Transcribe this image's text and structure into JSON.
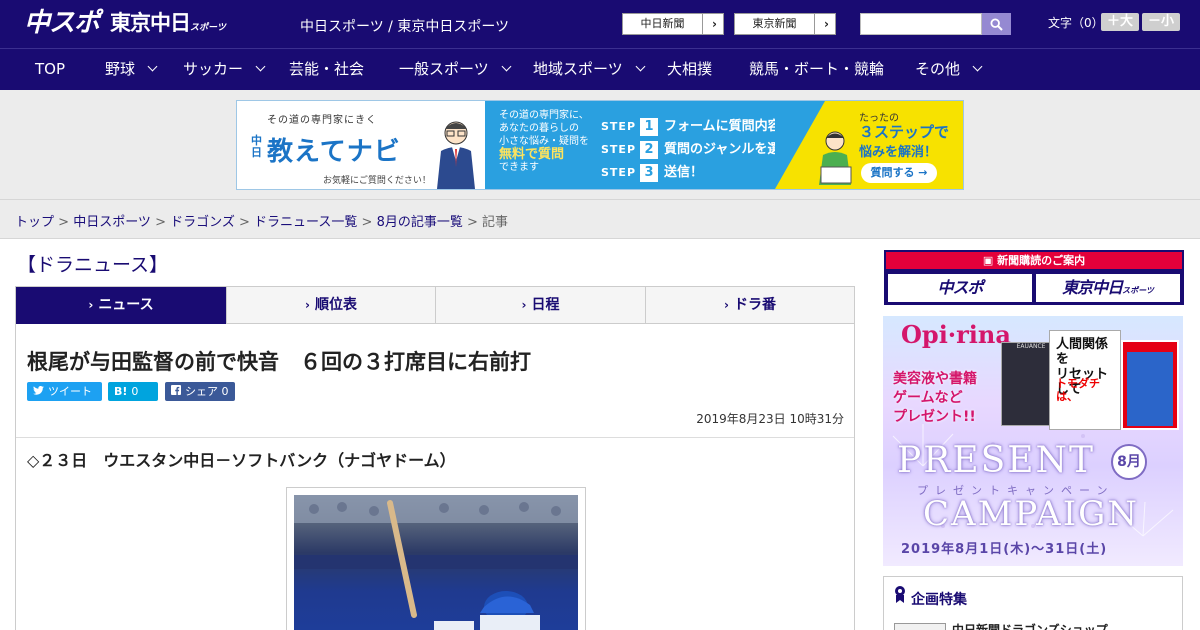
{
  "header": {
    "logo_chuspo": "中スポ",
    "logo_tokyo": "東京中日",
    "logo_tokyo_sub": "スポーツ",
    "site_names": "中日スポーツ / 東京中日スポーツ",
    "paper_buttons": [
      "中日新聞",
      "東京新聞"
    ],
    "search_placeholder": "",
    "fontsize_label": "文字（0）",
    "fontsize_up": "＋大",
    "fontsize_down": "－小"
  },
  "nav": {
    "items": [
      "TOP",
      "野球",
      "サッカー",
      "芸能・社会",
      "一般スポーツ",
      "地域スポーツ",
      "大相撲",
      "競馬・ボート・競輪",
      "その他"
    ]
  },
  "ad": {
    "tagline": "その道の専門家にきく",
    "kanji": "中日",
    "brand": "教えてナビ",
    "note": "お気軽にご質問ください！",
    "intro_1": "その道の専門家に、",
    "intro_2": "あなたの暮らしの",
    "intro_3": "小さな悩み・疑問を",
    "intro_4": "無料で質問",
    "intro_5": "できます",
    "steps": [
      {
        "label": "STEP",
        "num": "1",
        "text": "フォームに質問内容を入力"
      },
      {
        "label": "STEP",
        "num": "2",
        "text": "質問のジャンルを選択"
      },
      {
        "label": "STEP",
        "num": "3",
        "text": "送信！"
      }
    ],
    "right_1": "たったの",
    "right_2": "３ステップで",
    "right_3": "悩みを解消！",
    "cta": "質問する →"
  },
  "breadcrumb": {
    "items": [
      "トップ",
      "中日スポーツ",
      "ドラゴンズ",
      "ドラニュース一覧",
      "8月の記事一覧"
    ],
    "current": "記事"
  },
  "main": {
    "section_title": "【ドラニュース】",
    "tabs": [
      "ニュース",
      "順位表",
      "日程",
      "ドラ番"
    ],
    "headline": "根尾が与田監督の前で快音　６回の３打席目に右前打",
    "share": {
      "tweet": "ツイート",
      "hatena_icon": "B!",
      "hatena_count": "0",
      "facebook": "シェア",
      "facebook_count": "0"
    },
    "date": "2019年8月23日 10時31分",
    "subhead": "◇２３日　ウエスタン中日－ソフトバンク（ナゴヤドーム）"
  },
  "sidebar": {
    "subscribe_head": "新聞購読のご案内",
    "subscribe_logos": [
      "中スポ",
      "東京中日"
    ],
    "subscribe_logo_sub": "スポーツ",
    "campaign": {
      "brand": "Opi·rina",
      "text_1": "美容液や書籍",
      "text_2": "ゲームなど",
      "text_3": "プレゼント!!",
      "product": "EAUANCE",
      "book_1": "人間関係を",
      "book_2": "リセットして",
      "book_3": "トモダチは、",
      "present": "PRESENT",
      "kana": "プレゼントキャンペーン",
      "campaign": "CAMPAIGN",
      "month": "8月",
      "dates": "2019年8月1日(木)〜31日(土)"
    },
    "feature_title": "企画特集",
    "feature_link": "中日新聞ドラゴンズショップ"
  },
  "colors": {
    "brand_navy": "#190b72",
    "accent_red": "#e4003a",
    "twitter": "#1da1f2",
    "hatena": "#00a4de",
    "facebook": "#3b5998"
  }
}
